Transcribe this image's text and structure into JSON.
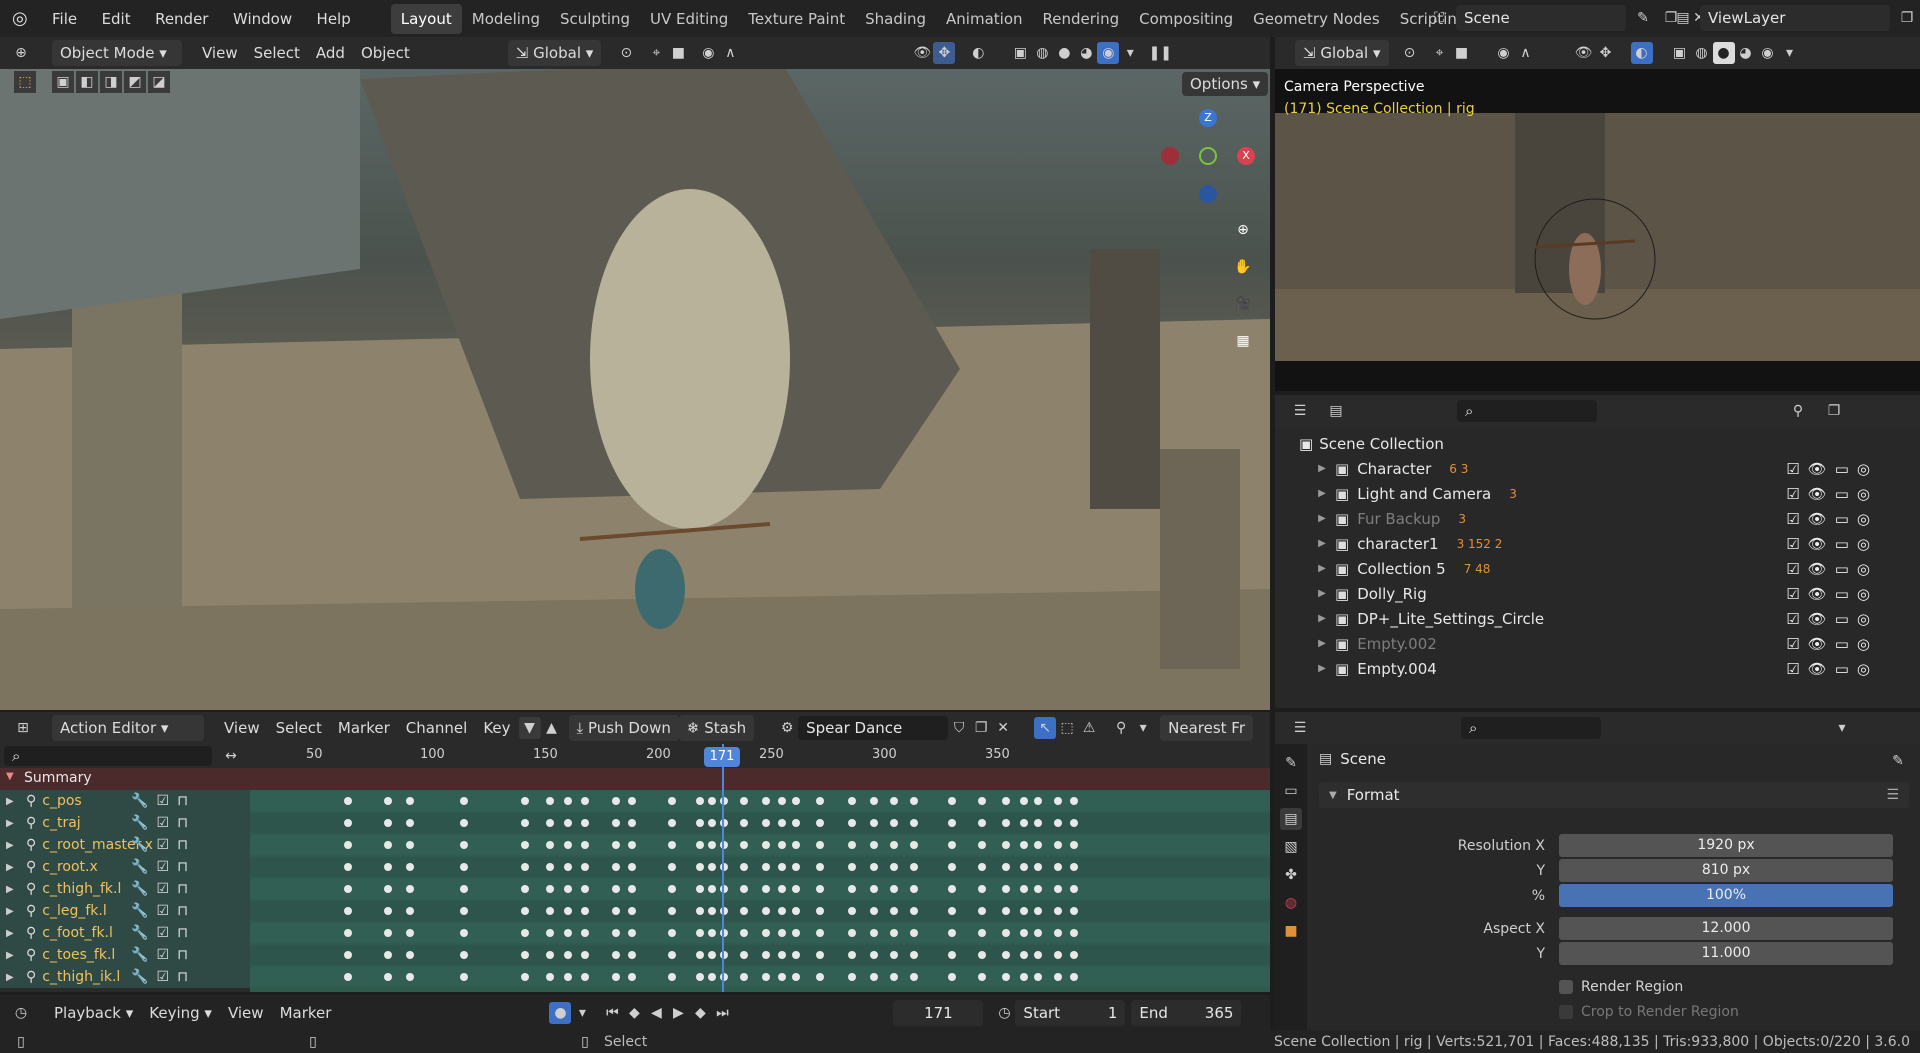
{
  "menubar": {
    "items": [
      "File",
      "Edit",
      "Render",
      "Window",
      "Help"
    ],
    "workspaces": [
      "Layout",
      "Modeling",
      "Sculpting",
      "UV Editing",
      "Texture Paint",
      "Shading",
      "Animation",
      "Rendering",
      "Compositing",
      "Geometry Nodes",
      "Scripting"
    ],
    "active_workspace": "Layout",
    "add_workspace": "+",
    "scene": "Scene",
    "view_layer": "ViewLayer"
  },
  "viewport_header": {
    "mode": "Object Mode",
    "menus": [
      "View",
      "Select",
      "Add",
      "Object"
    ],
    "transform_orientation": "Global",
    "options": "Options"
  },
  "gizmo": {
    "z": "Z",
    "x": "X"
  },
  "camera_view": {
    "orientation": "Global",
    "title": "Camera Perspective",
    "subtitle": "(171) Scene Collection | rig"
  },
  "outliner": {
    "root": "Scene Collection",
    "items": [
      {
        "name": "Character",
        "badges": "6  3",
        "dim": false
      },
      {
        "name": "Light and Camera",
        "badges": "3",
        "dim": false
      },
      {
        "name": "Fur Backup",
        "badges": "3",
        "dim": true
      },
      {
        "name": "character1",
        "badges": "3 152  2",
        "dim": false
      },
      {
        "name": "Collection 5",
        "badges": "7 48",
        "dim": false
      },
      {
        "name": "Dolly_Rig",
        "badges": "",
        "dim": false
      },
      {
        "name": "DP+_Lite_Settings_Circle",
        "badges": "",
        "dim": false
      },
      {
        "name": "Empty.002",
        "badges": "",
        "dim": true
      },
      {
        "name": "Empty.004",
        "badges": "",
        "dim": false
      }
    ]
  },
  "properties": {
    "context": "Scene",
    "panel": "Format",
    "resolution_x_label": "Resolution X",
    "resolution_x": "1920 px",
    "y_label": "Y",
    "resolution_y": "810 px",
    "percent_label": "%",
    "percent": "100%",
    "aspect_x_label": "Aspect X",
    "aspect_x": "12.000",
    "aspect_y_label": "Y",
    "aspect_y": "11.000",
    "render_region": "Render Region",
    "crop": "Crop to Render Region"
  },
  "action_editor": {
    "mode": "Action Editor",
    "menus": [
      "View",
      "Select",
      "Marker",
      "Channel",
      "Key"
    ],
    "push_down": "Push Down",
    "stash": "Stash",
    "action_name": "Spear Dance",
    "snap": "Nearest Fr",
    "ruler": [
      "50",
      "100",
      "150",
      "200",
      "250",
      "300",
      "350"
    ],
    "current_frame": "171",
    "summary": "Summary",
    "channels": [
      "c_pos",
      "c_traj",
      "c_root_master.x",
      "c_root.x",
      "c_thigh_fk.l",
      "c_leg_fk.l",
      "c_foot_fk.l",
      "c_toes_fk.l",
      "c_thigh_ik.l"
    ]
  },
  "playback": {
    "menus": [
      "Playback",
      "Keying",
      "View",
      "Marker"
    ],
    "frame": "171",
    "start_label": "Start",
    "start": "1",
    "end_label": "End",
    "end": "365"
  },
  "status": {
    "select": "Select",
    "info": "Scene Collection | rig | Verts:521,701 | Faces:488,135 | Tris:933,800 | Objects:0/220 | 3.6.0"
  }
}
